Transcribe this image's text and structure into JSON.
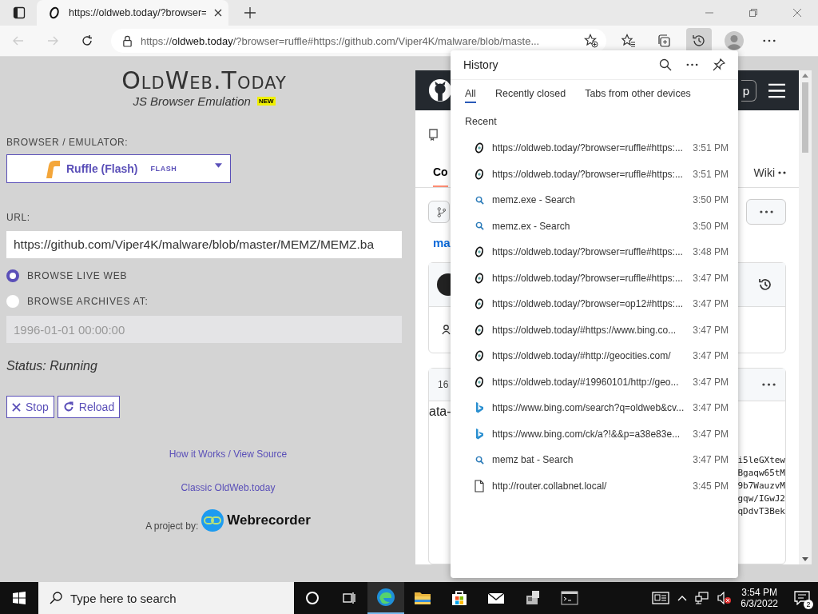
{
  "browser": {
    "tab_title": "https://oldweb.today/?browser=",
    "address_scheme": "https://",
    "address_host": "oldweb.today",
    "address_rest": "/?browser=ruffle#https://github.com/Viper4K/malware/blob/maste...",
    "toolbar": [
      {
        "kind": "favorites",
        "selected": false
      },
      {
        "kind": "collections",
        "selected": false
      },
      {
        "kind": "history",
        "selected": true
      },
      {
        "kind": "profile",
        "selected": false
      },
      {
        "kind": "more",
        "selected": false
      }
    ]
  },
  "app": {
    "title": "OldWeb.Today",
    "subtitle": "JS Browser Emulation",
    "badge": "NEW",
    "emulator_label": "BROWSER / EMULATOR:",
    "emulator_value": "Ruffle (Flash)",
    "emulator_tag": "FLASH",
    "url_label": "URL:",
    "url_value": "https://github.com/Viper4K/malware/blob/master/MEMZ/MEMZ.ba",
    "modes": [
      {
        "label": "BROWSE LIVE WEB",
        "selected": true
      },
      {
        "label": "BROWSE ARCHIVES AT:",
        "selected": false
      }
    ],
    "archive_date": {
      "value": "1996-01-01 00:00:00",
      "disabled": true
    },
    "status": "Status: Running",
    "buttons": [
      {
        "kind": "stop",
        "label": "Stop"
      },
      {
        "kind": "reload",
        "label": "Reload"
      }
    ],
    "links": [
      "How it Works / View Source",
      "Classic OldWeb.today"
    ],
    "credit": "A project by:",
    "credit_brand": "Webrecorder"
  },
  "frame": {
    "header_button": "p",
    "tab_fragment": "Co",
    "tab_right": "Wiki",
    "link_fragment": "ma",
    "count_fragment": "16",
    "text_fragment": "ata-",
    "code_lines": [
      "i5leGXtew",
      "Bgaqw65tM",
      "9b7WauzvM",
      "gqw/IGwJ2",
      "qDdvT3Bek"
    ]
  },
  "history": {
    "title": "History",
    "tabs": [
      {
        "label": "All",
        "selected": true
      },
      {
        "label": "Recently closed",
        "selected": false
      },
      {
        "label": "Tabs from other devices",
        "selected": false
      }
    ],
    "section": "Recent",
    "items": [
      {
        "kind": "oldweb",
        "text": "https://oldweb.today/?browser=ruffle#https:...",
        "time": "3:51 PM"
      },
      {
        "kind": "oldweb",
        "text": "https://oldweb.today/?browser=ruffle#https:...",
        "time": "3:51 PM"
      },
      {
        "kind": "search",
        "text": "memz.exe - Search",
        "time": "3:50 PM"
      },
      {
        "kind": "search",
        "text": "memz.ex - Search",
        "time": "3:50 PM"
      },
      {
        "kind": "oldweb",
        "text": "https://oldweb.today/?browser=ruffle#https:...",
        "time": "3:48 PM"
      },
      {
        "kind": "oldweb",
        "text": "https://oldweb.today/?browser=ruffle#https:...",
        "time": "3:47 PM"
      },
      {
        "kind": "oldweb",
        "text": "https://oldweb.today/?browser=op12#https:...",
        "time": "3:47 PM"
      },
      {
        "kind": "oldweb",
        "text": "https://oldweb.today/#https://www.bing.co...",
        "time": "3:47 PM"
      },
      {
        "kind": "oldweb",
        "text": "https://oldweb.today/#http://geocities.com/",
        "time": "3:47 PM"
      },
      {
        "kind": "oldweb",
        "text": "https://oldweb.today/#19960101/http://geo...",
        "time": "3:47 PM"
      },
      {
        "kind": "bing",
        "text": "https://www.bing.com/search?q=oldweb&cv...",
        "time": "3:47 PM"
      },
      {
        "kind": "bing",
        "text": "https://www.bing.com/ck/a?!&&p=a38e83e...",
        "time": "3:47 PM"
      },
      {
        "kind": "search",
        "text": "memz bat - Search",
        "time": "3:47 PM"
      },
      {
        "kind": "page",
        "text": "http://router.collabnet.local/",
        "time": "3:45 PM"
      }
    ]
  },
  "taskbar": {
    "search_placeholder": "Type here to search",
    "apps": [
      {
        "kind": "edge",
        "selected": true
      },
      {
        "kind": "explorer",
        "selected": false
      },
      {
        "kind": "store",
        "selected": false
      },
      {
        "kind": "mail",
        "selected": false
      },
      {
        "kind": "network",
        "selected": false
      },
      {
        "kind": "terminal",
        "selected": false
      }
    ],
    "time": "3:54 PM",
    "date": "6/3/2022",
    "notifications": "2"
  }
}
